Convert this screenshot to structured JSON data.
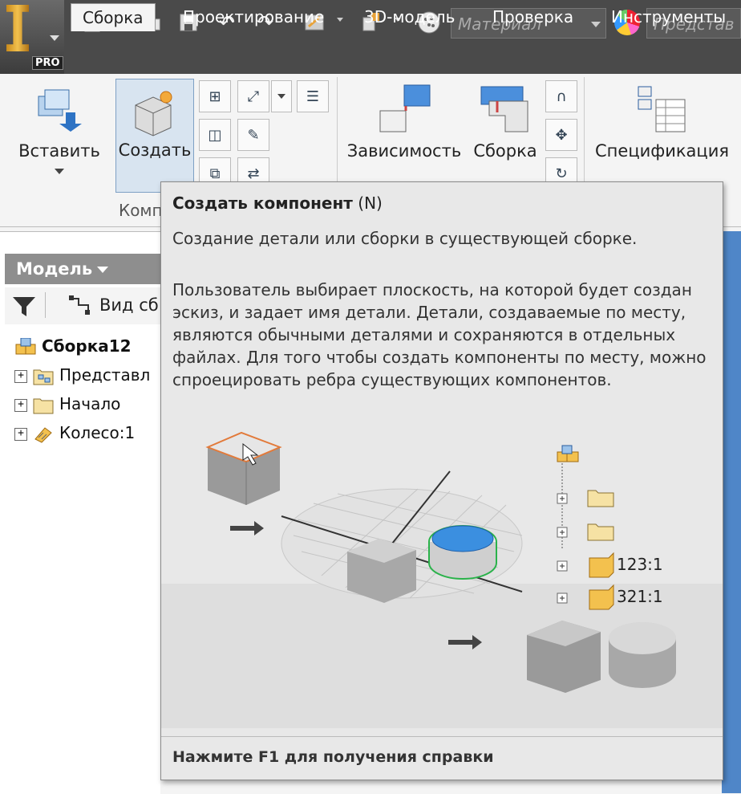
{
  "app": {
    "logo_badge": "PRO"
  },
  "quick_access": {
    "material_value": "Материал",
    "appearance_value": "Представ"
  },
  "tabs": [
    {
      "label": "Сборка",
      "active": true
    },
    {
      "label": "Проектирование",
      "active": false
    },
    {
      "label": "3D-модель",
      "active": false
    },
    {
      "label": "Проверка",
      "active": false
    },
    {
      "label": "Инструменты",
      "active": false
    }
  ],
  "ribbon": {
    "insert_label": "Вставить",
    "create_label": "Создать",
    "constraint_label": "Зависимость",
    "assemble_label": "Сборка",
    "bom_label": "Спецификация",
    "component_panel_label": "Комп"
  },
  "browser": {
    "header_label": "Модель",
    "view_label": "Вид сб",
    "root_label": "Сборка12",
    "items": [
      {
        "label": "Представл"
      },
      {
        "label": "Начало"
      },
      {
        "label": "Колесо:1"
      }
    ]
  },
  "tooltip": {
    "title": "Создать компонент",
    "shortcut": "(N)",
    "summary": "Создание детали или сборки в существующей сборке.",
    "description": "Пользователь выбирает плоскость, на которой будет создан эскиз, и задает имя детали. Детали, создаваемые по месту, являются обычными деталями и сохраняются в отдельных файлах. Для того чтобы создать компоненты по месту, можно спроецировать ребра существующих компонентов.",
    "illustration_items": [
      "123:1",
      "321:1"
    ],
    "footer": "Нажмите F1 для получения справки"
  },
  "colors": {
    "title_bar": "#4a4a4a",
    "ribbon_bg": "#f4f4f4",
    "tooltip_bg": "#e8e8e8",
    "selection": "#d8e4f0",
    "viewport": "#4f86c8"
  }
}
